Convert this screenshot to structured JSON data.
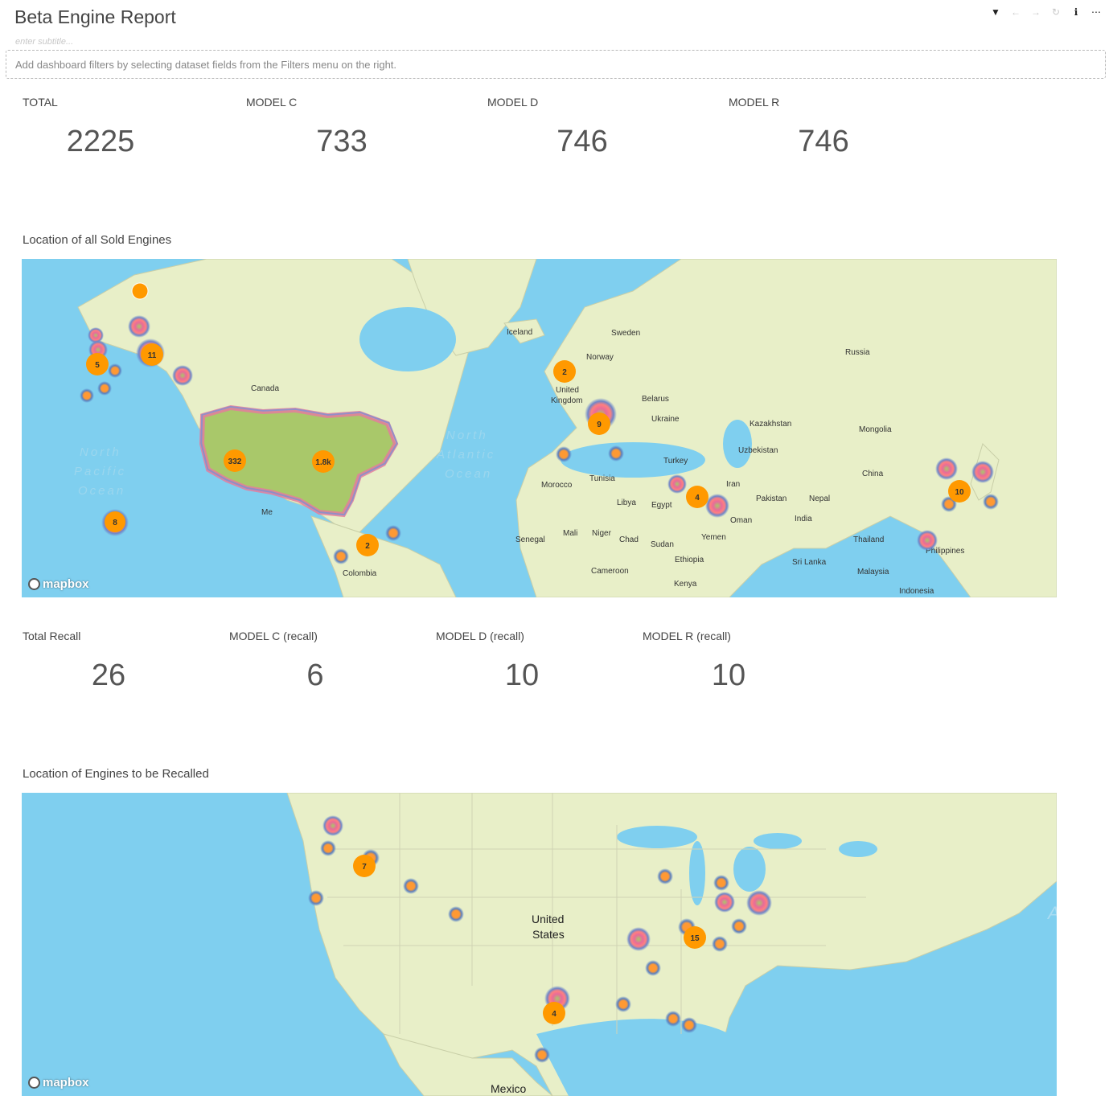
{
  "header": {
    "title": "Beta Engine Report",
    "subtitle_placeholder": "enter subtitle...",
    "toolbar": [
      {
        "name": "filter-icon",
        "glyph": "▼",
        "enabled": true
      },
      {
        "name": "undo-icon",
        "glyph": "←",
        "enabled": false
      },
      {
        "name": "redo-icon",
        "glyph": "→",
        "enabled": false
      },
      {
        "name": "refresh-icon",
        "glyph": "↻",
        "enabled": false
      },
      {
        "name": "info-icon",
        "glyph": "ℹ",
        "enabled": true
      },
      {
        "name": "more-icon",
        "glyph": "⋯",
        "enabled": true
      }
    ]
  },
  "filter_bar": {
    "text": "Add dashboard filters by selecting dataset fields from the Filters menu on the right."
  },
  "kpis_sold": [
    {
      "label": "TOTAL",
      "value": "2225"
    },
    {
      "label": "MODEL C",
      "value": "733"
    },
    {
      "label": "MODEL D",
      "value": "746"
    },
    {
      "label": "MODEL R",
      "value": "746"
    }
  ],
  "map_sold": {
    "title": "Location of all Sold Engines",
    "attribution": "mapbox",
    "oceans": [
      "North",
      "Pacific",
      "Ocean",
      "North",
      "Atlantic",
      "Ocean"
    ],
    "places": [
      "Iceland",
      "Sweden",
      "Norway",
      "Russia",
      "Canada",
      "United",
      "Kingdom",
      "Belarus",
      "Ukraine",
      "Kazakhstan",
      "Mongolia",
      "Uzbekistan",
      "Turkey",
      "China",
      "Iran",
      "Tunisia",
      "Morocco",
      "Libya",
      "Egypt",
      "Pakistan",
      "Nepal",
      "Oman",
      "India",
      "Yemen",
      "Mali",
      "Niger",
      "Chad",
      "Sudan",
      "Senegal",
      "Ethiopia",
      "Cameroon",
      "Kenya",
      "Colombia",
      "Thailand",
      "Sri Lanka",
      "Malaysia",
      "Indonesia",
      "Philippines",
      "Me"
    ],
    "clusters": [
      "5",
      "11",
      "332",
      "1.8k",
      "8",
      "2",
      "2",
      "9",
      "4",
      "10"
    ]
  },
  "kpis_recall": [
    {
      "label": "Total Recall",
      "value": "26"
    },
    {
      "label": "MODEL C (recall)",
      "value": "6"
    },
    {
      "label": "MODEL D (recall)",
      "value": "10"
    },
    {
      "label": "MODEL R (recall)",
      "value": "10"
    }
  ],
  "map_recall": {
    "title": "Location of Engines to be Recalled",
    "attribution": "mapbox",
    "places": [
      "United",
      "States",
      "Mexico",
      "A"
    ],
    "clusters": [
      "7",
      "15",
      "4"
    ]
  },
  "colors": {
    "water": "#7fcfef",
    "land": "#e8efc8",
    "cluster": "#ff9900",
    "heat_fill": "#a9c86a"
  }
}
